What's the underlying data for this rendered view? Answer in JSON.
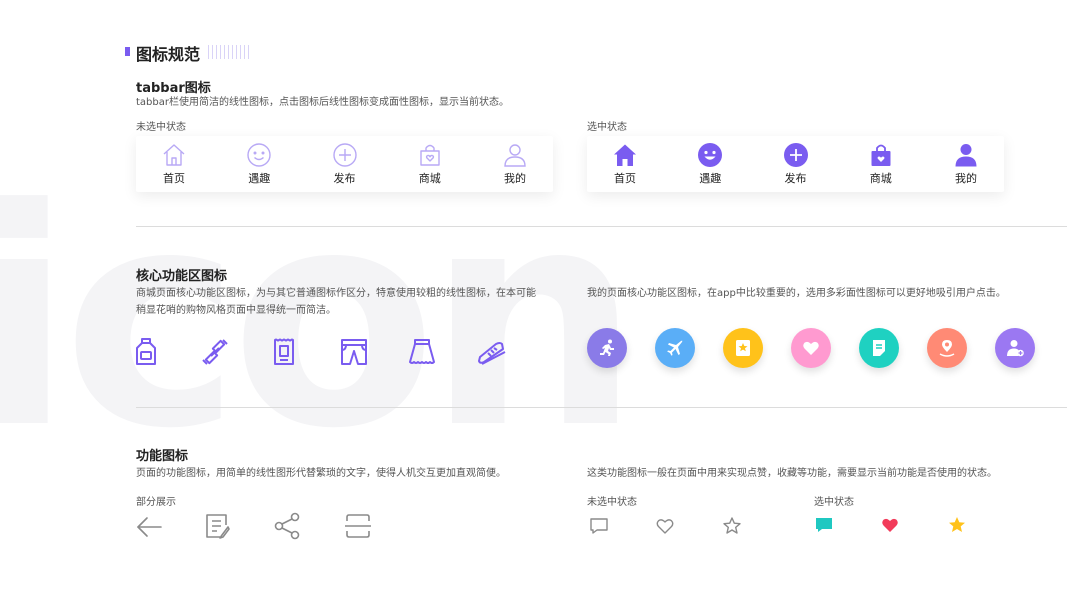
{
  "header": {
    "title": "图标规范"
  },
  "tabbar_section": {
    "title": "tabbar图标",
    "desc": "tabbar栏使用简洁的线性图标，点击图标后线性图标变成面性图标，显示当前状态。",
    "unselected_label": "未选中状态",
    "selected_label": "选中状态",
    "tabs": [
      {
        "label": "首页",
        "icon": "home-icon"
      },
      {
        "label": "遇趣",
        "icon": "smile-icon"
      },
      {
        "label": "发布",
        "icon": "plus-circle-icon"
      },
      {
        "label": "商城",
        "icon": "shopping-bag-icon"
      },
      {
        "label": "我的",
        "icon": "user-icon"
      }
    ],
    "accent": "#7a5cf0",
    "inactive": "#b8a9f5"
  },
  "core_section": {
    "title": "核心功能区图标",
    "desc_left_1": "商城页面核心功能区图标，为与其它普通图标作区分，特意使用较粗的线性图标，在本可能",
    "desc_left_2": "稍显花哨的购物风格页面中显得统一而简洁。",
    "desc_right": "我的页面核心功能区图标，在app中比较重要的，选用多彩面性图标可以更好地吸引用户点击。",
    "outline_icons": [
      "bottle-icon",
      "dumbbell-icon",
      "receipt-icon",
      "shorts-icon",
      "skirt-icon",
      "sneaker-icon"
    ],
    "color_icons": [
      {
        "icon": "running-icon",
        "color": "#8a7be8"
      },
      {
        "icon": "airplane-icon",
        "color": "#5aaef7"
      },
      {
        "icon": "star-badge-icon",
        "color": "#ffc21a"
      },
      {
        "icon": "heart-icon",
        "color": "#ff9ad0"
      },
      {
        "icon": "note-icon",
        "color": "#1fd1c1"
      },
      {
        "icon": "location-icon",
        "color": "#ff8a75"
      },
      {
        "icon": "user-add-icon",
        "color": "#9b78f2"
      }
    ]
  },
  "function_section": {
    "title": "功能图标",
    "desc_left": "页面的功能图标，用简单的线性图形代替繁琐的文字，使得人机交互更加直观简便。",
    "partial_label": "部分展示",
    "partial_icons": [
      "arrow-left-icon",
      "edit-note-icon",
      "share-icon",
      "scan-icon"
    ],
    "desc_right": "这类功能图标一般在页面中用来实现点赞，收藏等功能，需要显示当前功能是否使用的状态。",
    "unselected_label": "未选中状态",
    "selected_label": "选中状态",
    "state_icons": [
      "comment-icon",
      "heart-icon",
      "star-icon"
    ],
    "selected_colors": [
      "#1fc8c1",
      "#f23b5a",
      "#ffc21a"
    ]
  },
  "background_word": "icon"
}
